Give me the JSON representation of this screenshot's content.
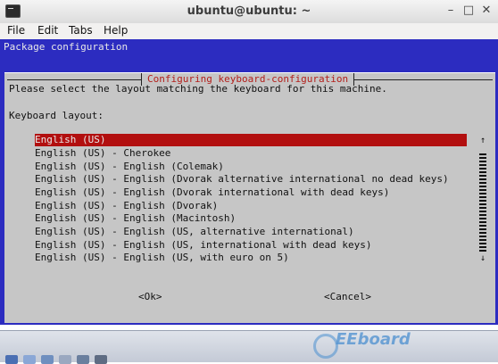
{
  "window": {
    "title": "ubuntu@ubuntu: ~",
    "minimize": "–",
    "maximize": "□",
    "close": "✕"
  },
  "menubar": [
    "File",
    "Edit",
    "Tabs",
    "Help"
  ],
  "terminal": {
    "package_title": "Package configuration",
    "dialog_title": "Configuring keyboard-configuration",
    "prompt": "Please select the layout matching the keyboard for this machine.",
    "field_label": "Keyboard layout:",
    "layouts": [
      "English (US)",
      "English (US) - Cherokee",
      "English (US) - English (Colemak)",
      "English (US) - English (Dvorak alternative international no dead keys)",
      "English (US) - English (Dvorak international with dead keys)",
      "English (US) - English (Dvorak)",
      "English (US) - English (Macintosh)",
      "English (US) - English (US, alternative international)",
      "English (US) - English (US, international with dead keys)",
      "English (US) - English (US, with euro on 5)"
    ],
    "selected_index": 0,
    "scroll_up": "↑",
    "scroll_down": "↓",
    "ok_label": "<Ok>",
    "cancel_label": "<Cancel>"
  },
  "watermark": "EEboard",
  "colors": {
    "terminal_bg": "#2c2cc0",
    "dialog_bg": "#c6c6c6",
    "selection": "#b20f0f",
    "dialog_title": "#b3201c"
  }
}
